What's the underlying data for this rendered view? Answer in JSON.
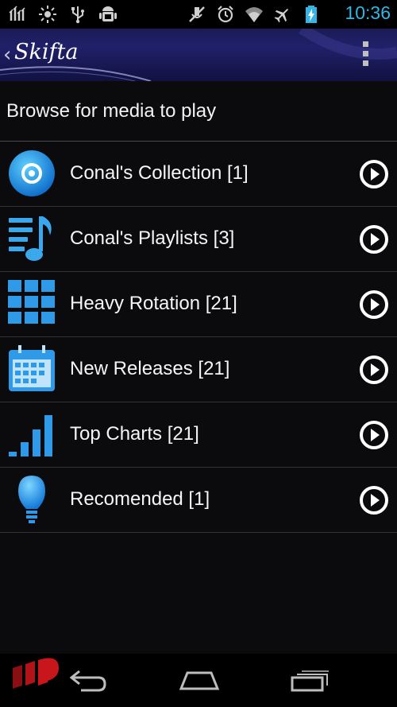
{
  "status_bar": {
    "time": "10:36",
    "left_icons": [
      "clear-notifications-icon",
      "brightness-icon",
      "usb-icon",
      "android-debug-icon"
    ],
    "right_icons": [
      "mute-icon",
      "alarm-icon",
      "wifi-icon",
      "airplane-mode-icon",
      "battery-charging-icon"
    ],
    "accent_color": "#33b5e5"
  },
  "action_bar": {
    "back_symbol": "‹",
    "logo_text": "Skifta",
    "menu_icon": "overflow-menu-icon"
  },
  "page": {
    "title": "Browse for media to play"
  },
  "media_list": [
    {
      "label": "Conal's Collection [1]",
      "icon": "disc-icon"
    },
    {
      "label": "Conal's Playlists [3]",
      "icon": "playlist-icon"
    },
    {
      "label": "Heavy Rotation [21]",
      "icon": "grid-icon"
    },
    {
      "label": "New Releases [21]",
      "icon": "calendar-icon"
    },
    {
      "label": "Top Charts [21]",
      "icon": "bar-chart-icon"
    },
    {
      "label": "Recomended [1]",
      "icon": "lightbulb-icon"
    }
  ],
  "nav_bar": {
    "buttons": [
      "back-icon",
      "home-icon",
      "recent-apps-icon"
    ],
    "app_icon": "app-logo-icon"
  }
}
